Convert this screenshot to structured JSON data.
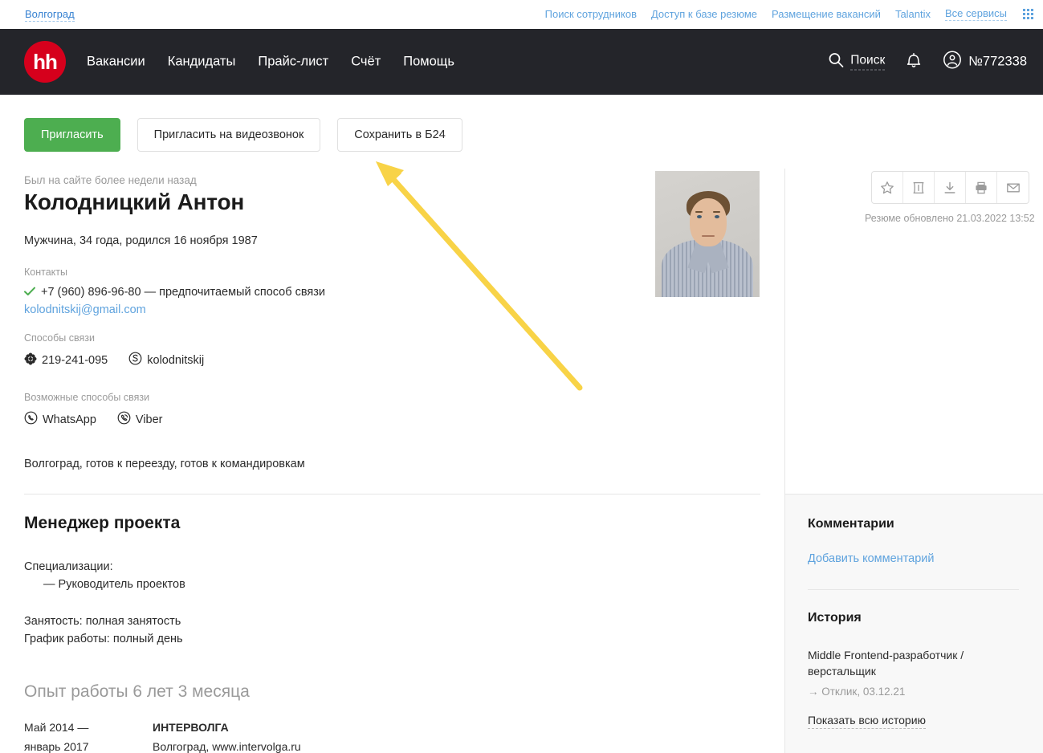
{
  "topbar": {
    "city": "Волгоград",
    "links": [
      {
        "label": "Поиск сотрудников"
      },
      {
        "label": "Доступ к базе резюме"
      },
      {
        "label": "Размещение вакансий"
      },
      {
        "label": "Talantix"
      },
      {
        "label": "Все сервисы"
      }
    ],
    "grid_icon": "apps-grid-icon"
  },
  "header": {
    "logo_text": "hh",
    "nav": [
      {
        "label": "Вакансии"
      },
      {
        "label": "Кандидаты"
      },
      {
        "label": "Прайс-лист"
      },
      {
        "label": "Счёт"
      },
      {
        "label": "Помощь"
      }
    ],
    "search_label": "Поиск",
    "search_icon": "search-icon",
    "bell_icon": "notification-bell-icon",
    "account_icon": "user-avatar-icon",
    "account_number": "№772338",
    "background_color": "#24252a",
    "logo_color": "#d6001c"
  },
  "actions": {
    "invite": "Пригласить",
    "invite_video": "Пригласить на видеозвонок",
    "save_b24": "Сохранить в Б24",
    "primary_color": "#4dae50"
  },
  "candidate": {
    "last_visit": "Был на сайте более недели назад",
    "name": "Колодницкий Антон",
    "summary": "Мужчина, 34 года, родился 16 ноября 1987",
    "contacts_label": "Контакты",
    "phone": "+7 (960) 896-96-80 — предпочитаемый способ связи",
    "phone_check_icon": "check-icon",
    "email": "kolodnitskij@gmail.com",
    "methods_label": "Способы связи",
    "methods": [
      {
        "icon": "icq-icon",
        "value": "219-241-095"
      },
      {
        "icon": "skype-icon",
        "value": "kolodnitskij"
      }
    ],
    "possible_methods_label": "Возможные способы связи",
    "possible_methods": [
      {
        "icon": "whatsapp-icon",
        "value": "WhatsApp"
      },
      {
        "icon": "viber-icon",
        "value": "Viber"
      }
    ],
    "location_line": "Волгоград, готов к переезду, готов к командировкам",
    "photo_alt": "candidate-photo"
  },
  "resume": {
    "role_title": "Менеджер проекта",
    "specializations_label": "Специализации:",
    "specializations": [
      {
        "label": "— Руководитель проектов"
      }
    ],
    "employment": "Занятость: полная занятость",
    "schedule": "График работы: полный день",
    "experience_title": "Опыт работы 6 лет 3 месяца",
    "experience": [
      {
        "date_from": "Май 2014 —",
        "date_to": "январь 2017",
        "company": "ИНТЕРВОЛГА",
        "place": "Волгоград, www.intervolga.ru"
      }
    ]
  },
  "toolbar": {
    "buttons": [
      {
        "icon": "star-icon",
        "name": "favorite"
      },
      {
        "icon": "box-icon",
        "name": "archive"
      },
      {
        "icon": "download-icon",
        "name": "download"
      },
      {
        "icon": "printer-icon",
        "name": "print"
      },
      {
        "icon": "envelope-icon",
        "name": "email"
      }
    ],
    "updated_text": "Резюме обновлено 21.03.2022 13:52"
  },
  "sidebar": {
    "comments_title": "Комментарии",
    "add_comment": "Добавить комментарий",
    "history_title": "История",
    "history_item_title": "Middle Frontend-разработчик / верстальщик",
    "history_item_meta": "→ Отклик, 03.12.21",
    "show_all_history": "Показать всю историю"
  },
  "annotation": {
    "arrow_color": "#f8d347",
    "arrow_name": "pointer-arrow-to-save-b24"
  }
}
